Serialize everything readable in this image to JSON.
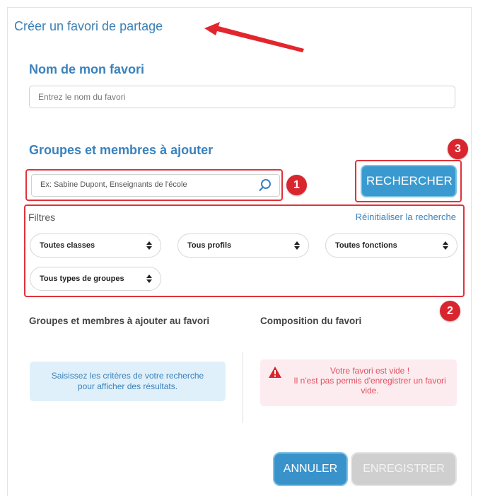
{
  "page_title": "Créer un favori de partage",
  "name_section": {
    "title": "Nom de mon favori",
    "input_value": "",
    "input_placeholder": "Entrez le nom du favori"
  },
  "members_section": {
    "title": "Groupes et membres à ajouter",
    "search_value": "",
    "search_placeholder": "Ex: Sabine Dupont, Enseignants de l'école",
    "search_button": "RECHERCHER"
  },
  "filters": {
    "label": "Filtres",
    "reset_link": "Réinitialiser la recherche",
    "selects": [
      "Toutes classes",
      "Tous profils",
      "Toutes fonctions",
      "Tous types de groupes"
    ]
  },
  "results": {
    "left_title": "Groupes et membres à ajouter au favori",
    "left_message": "Saisissez les critères de votre recherche pour afficher des résultats.",
    "right_title": "Composition du favori",
    "warning_line1": "Votre favori est vide !",
    "warning_line2": "Il n'est pas permis d'enregistrer un favori vide."
  },
  "footer": {
    "cancel": "ANNULER",
    "save": "ENREGISTRER"
  },
  "annotations": [
    "1",
    "2",
    "3"
  ],
  "colors": {
    "accent": "#3a82bd",
    "button": "#3a9ad0",
    "annotation": "#e0323a",
    "warning": "#e25060"
  }
}
